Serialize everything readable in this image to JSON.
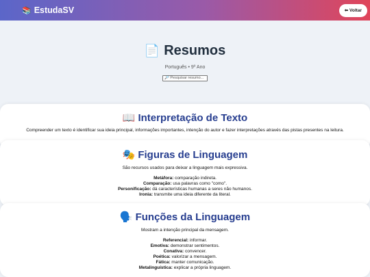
{
  "header": {
    "brand_icon": "📚",
    "brand": "EstudaSV",
    "back_label": "⬅ Voltar"
  },
  "hero": {
    "icon": "📄",
    "title": "Resumos",
    "subtitle": "Português • 9º Ano",
    "search_placeholder": "🔎 Pesquisar resumo..."
  },
  "cards": [
    {
      "icon": "📖",
      "title": "Interpretação de Texto",
      "description": "Compreender um texto é identificar sua ideia principal, informações importantes, intenção do autor e fazer interpretações através das pistas presentes na leitura.",
      "items": []
    },
    {
      "icon": "🎭",
      "title": "Figuras de Linguagem",
      "description": "São recursos usados para deixar a linguagem mais expressiva.",
      "items": [
        {
          "term": "Metáfora:",
          "text": " comparação indireta."
        },
        {
          "term": "Comparação:",
          "text": " usa palavras como \"como\"."
        },
        {
          "term": "Personificação:",
          "text": " dá características humanas a seres não humanos."
        },
        {
          "term": "Ironia:",
          "text": " transmite uma ideia diferente da literal."
        }
      ]
    },
    {
      "icon": "🗣️",
      "title": "Funções da Linguagem",
      "description": "Mostram a intenção principal da mensagem.",
      "items": [
        {
          "term": "Referencial:",
          "text": " informar."
        },
        {
          "term": "Emotiva:",
          "text": " demonstrar sentimentos."
        },
        {
          "term": "Conativa:",
          "text": " convencer."
        },
        {
          "term": "Poética:",
          "text": " valorizar a mensagem."
        },
        {
          "term": "Fática:",
          "text": " manter comunicação."
        },
        {
          "term": "Metalinguística:",
          "text": " explicar a própria linguagem."
        }
      ]
    }
  ]
}
